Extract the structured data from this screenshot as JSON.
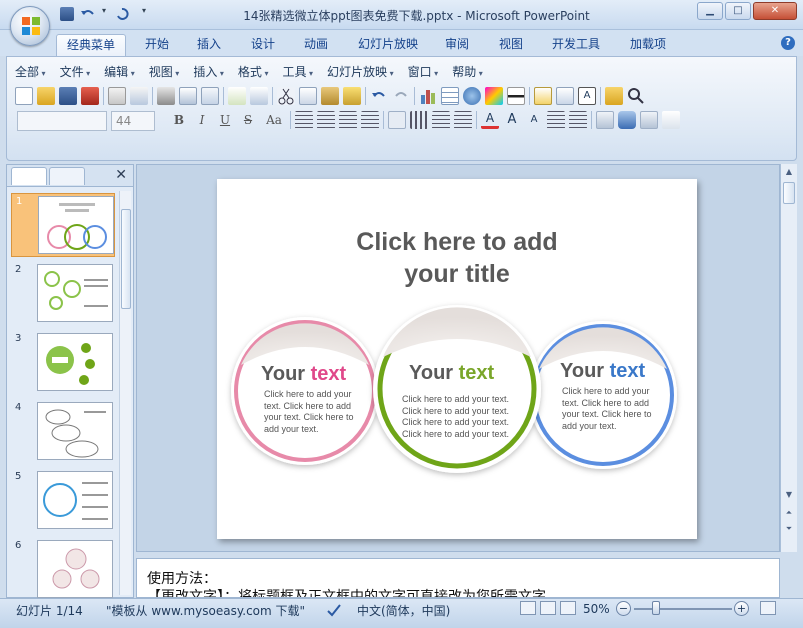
{
  "window": {
    "title": "14张精选微立体ppt图表免费下载.pptx - Microsoft PowerPoint",
    "minimize": "▁",
    "maximize": "□",
    "close": "✕"
  },
  "tabs": [
    "经典菜单",
    "开始",
    "插入",
    "设计",
    "动画",
    "幻灯片放映",
    "审阅",
    "视图",
    "开发工具",
    "加载项"
  ],
  "active_tab": "经典菜单",
  "help": "?",
  "menus": [
    "全部",
    "文件",
    "编辑",
    "视图",
    "插入",
    "格式",
    "工具",
    "幻灯片放映",
    "窗口",
    "帮助"
  ],
  "font": {
    "name": "",
    "size": "44"
  },
  "format_buttons": [
    "B",
    "I",
    "U",
    "S",
    "Aa"
  ],
  "thumbnails": {
    "numbers": [
      "1",
      "2",
      "3",
      "4",
      "5",
      "6"
    ],
    "selected": "1",
    "close": "✕"
  },
  "slide": {
    "title_line1": "Click here to add",
    "title_line2": "your title",
    "bubbles": [
      {
        "head1": "Your ",
        "head2": "text",
        "accent": "#e0488a",
        "ring": "#e78aa9",
        "lines": [
          "Click here to add your",
          "text. Click here to add",
          "your text. Click here to",
          "add your text."
        ]
      },
      {
        "head1": "Your ",
        "head2": "text",
        "accent": "#7aa62a",
        "ring": "#6fa518",
        "lines": [
          "Click here to add your text.",
          "Click here to add your text.",
          "Click here to add your text.",
          "Click here to add your text."
        ]
      },
      {
        "head1": "Your ",
        "head2": "text",
        "accent": "#3a78c9",
        "ring": "#5b8ee0",
        "lines": [
          "Click here to add your",
          "text. Click here to add",
          "your text. Click here to",
          "add your text."
        ]
      }
    ]
  },
  "notes": {
    "line1": "使用方法：",
    "line2": "【更改文字】：将标题框及正文框中的文字可直接改为您所需文字"
  },
  "status": {
    "slide": "幻灯片 1/14",
    "template": "\"模板从 www.mysoeasy.com 下载\"",
    "language": "中文(简体，中国)",
    "zoom": "50%"
  },
  "colors": {
    "accent_pink": "#e0488a",
    "accent_green": "#6fa518",
    "accent_blue": "#3a78c9"
  }
}
